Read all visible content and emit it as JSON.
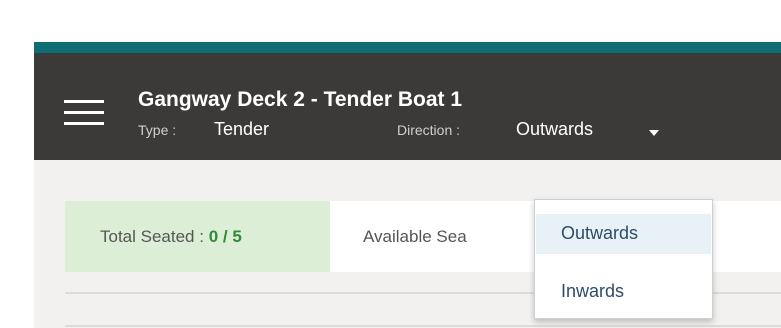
{
  "header": {
    "title": "Gangway Deck 2 - Tender Boat 1",
    "type_label": "Type :",
    "type_value": "Tender",
    "direction_label": "Direction :",
    "direction_value": "Outwards"
  },
  "stats": {
    "total_seated_label": "Total Seated :",
    "total_seated_value": "0 / 5",
    "available_label": "Available Sea"
  },
  "dropdown": {
    "options": [
      "Outwards",
      "Inwards"
    ],
    "selected": "Outwards"
  },
  "colors": {
    "accent": "#0f6e73",
    "header_bg": "#3b3a38",
    "seated_bg": "#dcefd6",
    "seated_value": "#2e8b3a"
  },
  "icons": {
    "menu": "hamburger-menu-icon",
    "direction": "caret-down-icon"
  }
}
